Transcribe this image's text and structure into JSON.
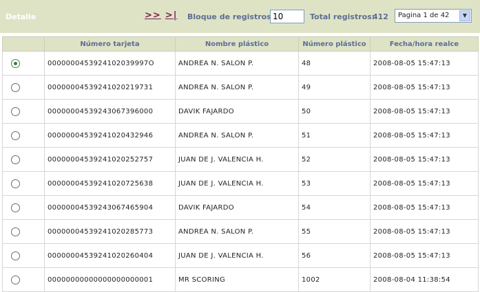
{
  "header": {
    "detalle": "Detalle",
    "nav_next": ">>",
    "nav_last": ">|",
    "bloque_label": "Bloque de registros:",
    "bloque_value": "10",
    "total_label": "Total registros:",
    "total_value": "412",
    "page_select": "Pagina 1 de 42"
  },
  "table": {
    "columns": [
      "",
      "Número tarjeta",
      "Nombre plástico",
      "Número plástico",
      "Fecha/hora realce"
    ],
    "rows": [
      {
        "selected": true,
        "tarjeta": "0000000453924102039997O",
        "nombre": "ANDREA N. SALON P.",
        "numero": "48",
        "fecha": "2008-08-05 15:47:13"
      },
      {
        "selected": false,
        "tarjeta": "00000004539241020219731",
        "nombre": "ANDREA N. SALON P.",
        "numero": "49",
        "fecha": "2008-08-05 15:47:13"
      },
      {
        "selected": false,
        "tarjeta": "00000004539243067396000",
        "nombre": "DAVIK FAJARDO",
        "numero": "50",
        "fecha": "2008-08-05 15:47:13"
      },
      {
        "selected": false,
        "tarjeta": "00000004539241020432946",
        "nombre": "ANDREA N. SALON P.",
        "numero": "51",
        "fecha": "2008-08-05 15:47:13"
      },
      {
        "selected": false,
        "tarjeta": "00000004539241020252757",
        "nombre": "JUAN DE J. VALENCIA H.",
        "numero": "52",
        "fecha": "2008-08-05 15:47:13"
      },
      {
        "selected": false,
        "tarjeta": "00000004539241020725638",
        "nombre": "JUAN DE J. VALENCIA H.",
        "numero": "53",
        "fecha": "2008-08-05 15:47:13"
      },
      {
        "selected": false,
        "tarjeta": "00000004539243067465904",
        "nombre": "DAVIK FAJARDO",
        "numero": "54",
        "fecha": "2008-08-05 15:47:13"
      },
      {
        "selected": false,
        "tarjeta": "00000004539241020285773",
        "nombre": "ANDREA N. SALON P.",
        "numero": "55",
        "fecha": "2008-08-05 15:47:13"
      },
      {
        "selected": false,
        "tarjeta": "00000004539241020260404",
        "nombre": "JUAN DE J. VALENCIA H.",
        "numero": "56",
        "fecha": "2008-08-05 15:47:13"
      },
      {
        "selected": false,
        "tarjeta": "00000000000000000000001",
        "nombre": "MR SCORING",
        "numero": "1002",
        "fecha": "2008-08-04 11:38:54"
      }
    ]
  }
}
